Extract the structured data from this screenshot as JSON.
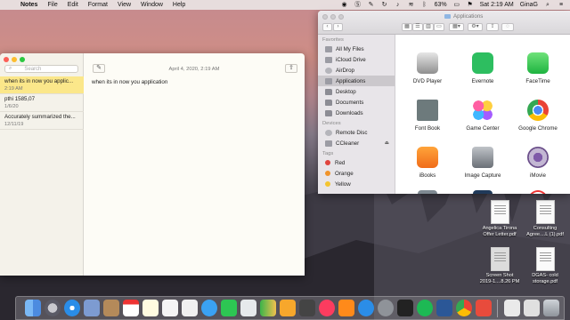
{
  "menubar": {
    "app_name": "Notes",
    "menus": [
      "File",
      "Edit",
      "Format",
      "View",
      "Window",
      "Help"
    ],
    "battery": "63%",
    "clock": "Sat 2:19 AM",
    "user": "GinaG"
  },
  "notes": {
    "search_placeholder": "Search",
    "items": [
      {
        "title": "when its in now you applic...",
        "date": "2:19 AM"
      },
      {
        "title": "pthi 1585,07",
        "date": "1/6/20"
      },
      {
        "title": "Accurately summarized the...",
        "date": "12/11/19"
      }
    ],
    "editor_date": "April 4, 2020, 2:19 AM",
    "editor_body": "when its in now you application"
  },
  "finder": {
    "title": "Applications",
    "sections": {
      "favorites": "Favorites",
      "devices": "Devices",
      "tags": "Tags"
    },
    "favorites": [
      {
        "label": "All My Files",
        "icon": "all-files-icon"
      },
      {
        "label": "iCloud Drive",
        "icon": "cloud-icon"
      },
      {
        "label": "AirDrop",
        "icon": "airdrop-icon"
      },
      {
        "label": "Applications",
        "icon": "applications-icon"
      },
      {
        "label": "Desktop",
        "icon": "folder-icon"
      },
      {
        "label": "Documents",
        "icon": "folder-icon"
      },
      {
        "label": "Downloads",
        "icon": "folder-icon"
      }
    ],
    "devices": [
      {
        "label": "Remote Disc",
        "icon": "disc-icon"
      },
      {
        "label": "CCleaner",
        "icon": "disk-icon"
      }
    ],
    "tags": [
      {
        "label": "Red",
        "color": "#e0443e"
      },
      {
        "label": "Orange",
        "color": "#f0932b"
      },
      {
        "label": "Yellow",
        "color": "#f4c430"
      }
    ],
    "apps": [
      {
        "label": "DVD Player",
        "icon": "dvd-player-icon"
      },
      {
        "label": "Evernote",
        "icon": "evernote-icon"
      },
      {
        "label": "FaceTime",
        "icon": "facetime-icon"
      },
      {
        "label": "Font Book",
        "icon": "font-book-icon"
      },
      {
        "label": "Game Center",
        "icon": "game-center-icon"
      },
      {
        "label": "Google Chrome",
        "icon": "chrome-icon"
      },
      {
        "label": "iBooks",
        "icon": "ibooks-icon"
      },
      {
        "label": "Image Capture",
        "icon": "image-capture-icon"
      },
      {
        "label": "iMovie",
        "icon": "imovie-icon"
      }
    ]
  },
  "desktop_files": [
    {
      "label_1": "Angelica Tirona",
      "label_2": "Offer Letter.pdf"
    },
    {
      "label_1": "Consulting",
      "label_2": "Agree....L (1).pdf"
    },
    {
      "label_1": "Screen Shot",
      "label_2": "2019-1....8.26 PM"
    },
    {
      "label_1": "DGAS- cold",
      "label_2": "storage.pdf"
    }
  ],
  "colors": {
    "notes_selection": "#fbe78a",
    "finder_selection": "#cbc8cc"
  }
}
